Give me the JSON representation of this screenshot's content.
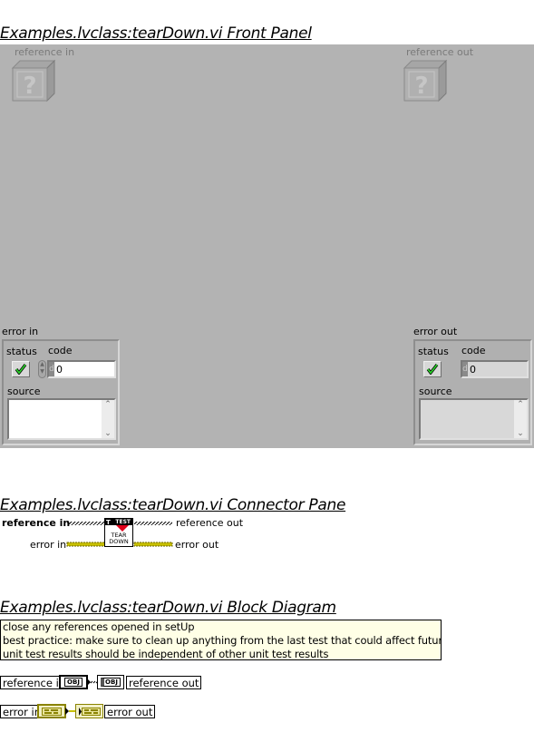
{
  "front_panel": {
    "title": "Examples.lvclass:tearDown.vi Front Panel",
    "reference_in": {
      "label": "reference in",
      "icon": "question-class-icon"
    },
    "reference_out": {
      "label": "reference out",
      "icon": "question-class-icon"
    },
    "error_in": {
      "label": "error in",
      "status_label": "status",
      "status_value": "check",
      "code_label": "code",
      "code_radix": "d",
      "code_value": "0",
      "source_label": "source",
      "source_value": ""
    },
    "error_out": {
      "label": "error out",
      "status_label": "status",
      "status_value": "check",
      "code_label": "code",
      "code_radix": "d",
      "code_value": "0",
      "source_label": "source",
      "source_value": ""
    }
  },
  "connector_pane": {
    "title": "Examples.lvclass:tearDown.vi Connector Pane",
    "left_terminals": [
      "reference in",
      "error in"
    ],
    "right_terminals": [
      "reference out",
      "error out"
    ],
    "icon_banner": "TEST",
    "icon_text_line1": "TEAR",
    "icon_text_line2": "DOWN"
  },
  "block_diagram": {
    "title": "Examples.lvclass:tearDown.vi Block Diagram",
    "comment_lines": [
      "close any references opened in setUp",
      "best practice: make sure to clean up anything from the last test that could affect future tests",
      "unit test results should be independent of other unit test results"
    ],
    "reference_in_label": "reference in",
    "reference_out_label": "reference out",
    "obj_text": "OBJ",
    "error_in_label": "error in",
    "error_out_label": "error out"
  },
  "colors": {
    "panel_bg": "#b3b3b3",
    "comment_bg": "#ffffe6",
    "error_wire": "#b0a800",
    "status_check": "#20d020"
  }
}
